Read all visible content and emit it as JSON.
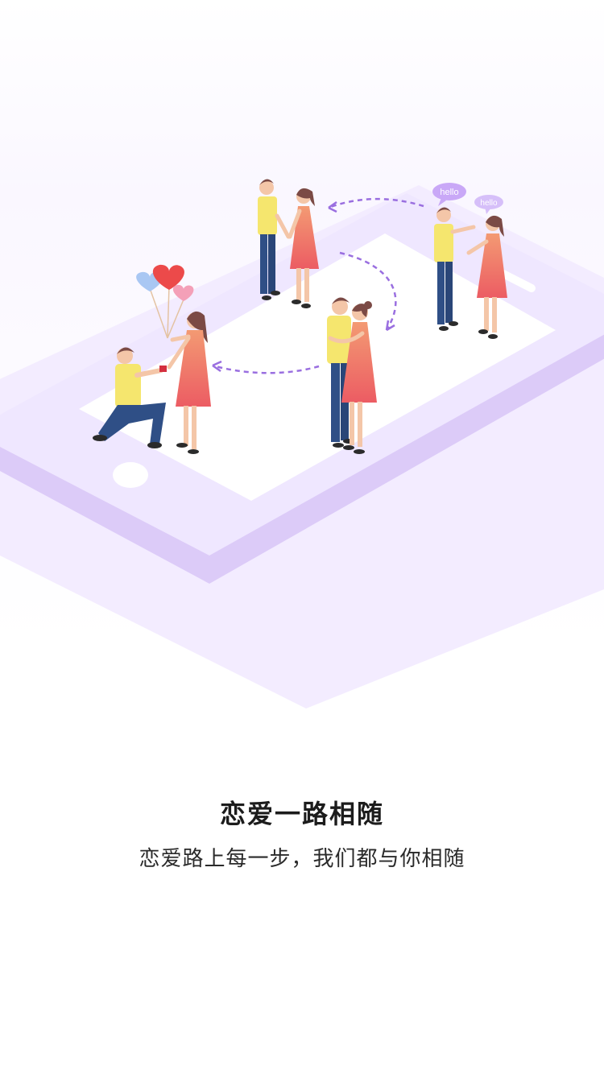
{
  "onboarding": {
    "title": "恋爱一路相随",
    "subtitle": "恋爱路上每一步，我们都与你相随"
  },
  "illustration": {
    "bubble_left": "hello",
    "bubble_right": "hello",
    "colors": {
      "accent": "#dccbf8",
      "platform": "#f2ebff",
      "shirt": "#f5e66e",
      "pants": "#2f4f86",
      "dress": "#ee6b63",
      "skin": "#f4c6a8",
      "hair": "#7b4a45"
    }
  }
}
